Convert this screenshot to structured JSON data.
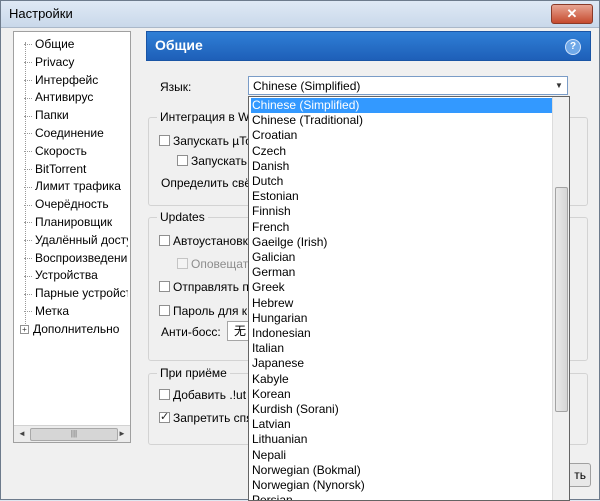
{
  "window": {
    "title": "Настройки",
    "close_label": "✕"
  },
  "tree": {
    "items": [
      {
        "label": "Общие"
      },
      {
        "label": "Privacy"
      },
      {
        "label": "Интерфейс"
      },
      {
        "label": "Антивирус"
      },
      {
        "label": "Папки"
      },
      {
        "label": "Соединение"
      },
      {
        "label": "Скорость"
      },
      {
        "label": "BitTorrent"
      },
      {
        "label": "Лимит трафика"
      },
      {
        "label": "Очерёдность"
      },
      {
        "label": "Планировщик"
      },
      {
        "label": "Удалённый досту"
      },
      {
        "label": "Воспроизведени"
      },
      {
        "label": "Устройства"
      },
      {
        "label": "Парные устройст"
      },
      {
        "label": "Метка"
      },
      {
        "label": "Дополнительно"
      }
    ],
    "expand_glyph": "+",
    "scroll_left": "◄",
    "scroll_right": "►",
    "scroll_grip": "|||"
  },
  "panel": {
    "title": "Общие",
    "help": "?",
    "language_label": "Язык:",
    "language_value": "Chinese (Simplified)",
    "windows_group": {
      "title": "Интеграция в W",
      "start_utorrent": "Запускать µTo",
      "start_minimized": "Запускать",
      "detect_label": "Определить свё"
    },
    "updates_group": {
      "title": "Updates",
      "auto_install": "Автоустановка",
      "notify": "Оповещат",
      "send": "Отправлять п",
      "password": "Пароль для к",
      "boss_label": "Анти-босс:",
      "boss_value": "无"
    },
    "on_receive_group": {
      "title": "При приёме",
      "add_ut": "Добавить .!ut",
      "forbid": "Запретить спя"
    },
    "bottom_button": "ть"
  },
  "dropdown": {
    "selected_index": 0,
    "options": [
      "Chinese (Simplified)",
      "Chinese (Traditional)",
      "Croatian",
      "Czech",
      "Danish",
      "Dutch",
      "Estonian",
      "Finnish",
      "French",
      "Gaeilge (Irish)",
      "Galician",
      "German",
      "Greek",
      "Hebrew",
      "Hungarian",
      "Indonesian",
      "Italian",
      "Japanese",
      "Kabyle",
      "Korean",
      "Kurdish (Sorani)",
      "Latvian",
      "Lithuanian",
      "Nepali",
      "Norwegian (Bokmal)",
      "Norwegian (Nynorsk)",
      "Persian"
    ]
  },
  "colors": {
    "accent": "#1e5fb8",
    "selection": "#3399ff"
  }
}
